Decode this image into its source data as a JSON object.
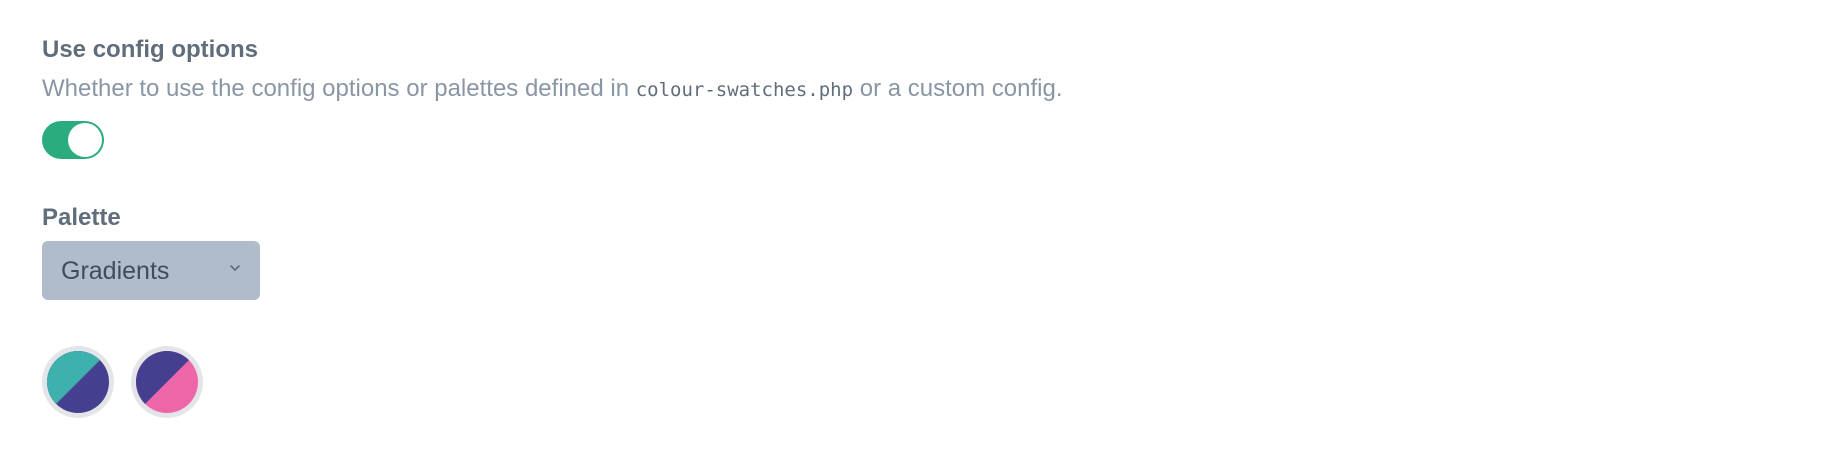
{
  "config_field": {
    "label": "Use config options",
    "instructions_before": "Whether to use the config options or palettes defined in ",
    "instructions_code": "colour-swatches.php",
    "instructions_after": " or a custom config.",
    "toggle_on": true,
    "toggle_color": "#2bac7e"
  },
  "palette_field": {
    "label": "Palette",
    "selected": "Gradients",
    "select_bg": "#b0bccc"
  },
  "swatches": [
    {
      "name": "swatch-1",
      "color_a": "#3fb1ac",
      "color_b": "#453f8f"
    },
    {
      "name": "swatch-2",
      "color_a": "#453f8f",
      "color_b": "#ec66a8"
    }
  ]
}
